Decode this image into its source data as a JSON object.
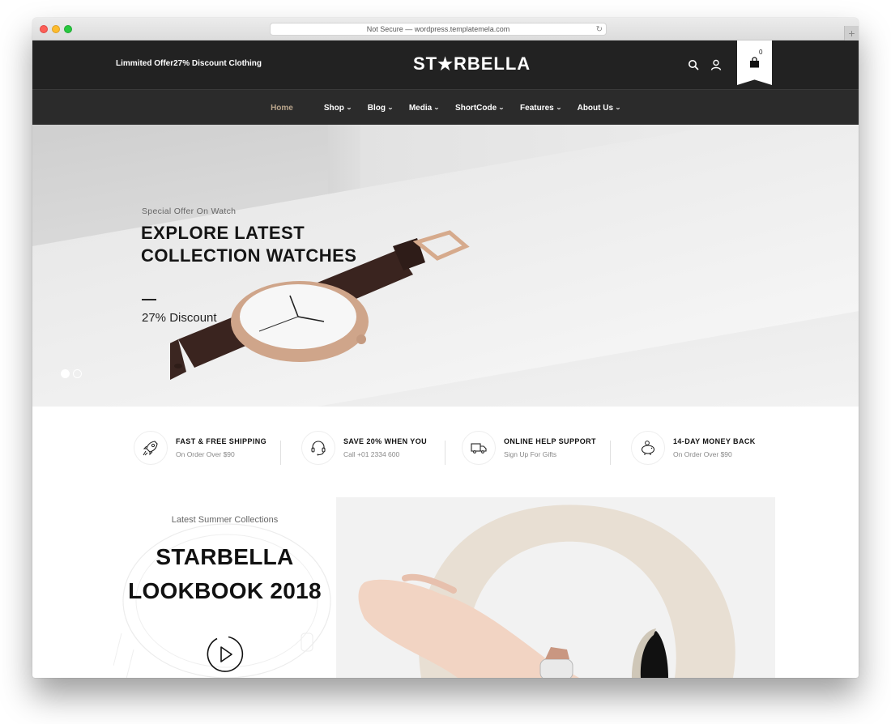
{
  "browser": {
    "url_text": "Not Secure — wordpress.templatemela.com",
    "reload_icon": "reload-icon",
    "new_tab_icon": "plus-icon",
    "new_tab_glyph": "+"
  },
  "header": {
    "promo": "Limmited Offer27% Discount Clothing",
    "logo_left": "ST",
    "logo_star": "★",
    "logo_right": "RBELLA",
    "icons": [
      "search-icon",
      "user-icon",
      "shopping-bag-icon"
    ],
    "cart_count": "0"
  },
  "nav": {
    "items": [
      {
        "label": "Home",
        "active": true,
        "dropdown": false
      },
      {
        "label": "Shop",
        "active": false,
        "dropdown": true
      },
      {
        "label": "Blog",
        "active": false,
        "dropdown": true
      },
      {
        "label": "Media",
        "active": false,
        "dropdown": true
      },
      {
        "label": "ShortCode",
        "active": false,
        "dropdown": true
      },
      {
        "label": "Features",
        "active": false,
        "dropdown": true
      },
      {
        "label": "About Us",
        "active": false,
        "dropdown": true
      }
    ],
    "chevron": "⌄",
    "active_color": "#b8a48b"
  },
  "hero": {
    "subtitle": "Special Offer On Watch",
    "title_line1": "EXPLORE LATEST",
    "title_line2": "COLLECTION WATCHES",
    "discount": "27% Discount",
    "slides": 2,
    "active_slide": 1
  },
  "features": [
    {
      "icon": "rocket-icon",
      "title": "FAST & FREE SHIPPING",
      "subtitle": "On Order Over $90"
    },
    {
      "icon": "headset-icon",
      "title": "SAVE 20% WHEN YOU",
      "subtitle": "Call +01 2334 600"
    },
    {
      "icon": "truck-icon",
      "title": "ONLINE HELP SUPPORT",
      "subtitle": "Sign Up For Gifts"
    },
    {
      "icon": "piggy-bank-icon",
      "title": "14-DAY MONEY BACK",
      "subtitle": "On Order Over $90"
    }
  ],
  "lookbook": {
    "subtitle": "Latest Summer Collections",
    "title_line1": "STARBELLA",
    "title_line2": "LOOKBOOK 2018",
    "play_icon": "play-icon"
  },
  "colors": {
    "topbar": "#222222",
    "navbar": "#2b2b2b",
    "accent_ring": "#e8dfd3"
  }
}
